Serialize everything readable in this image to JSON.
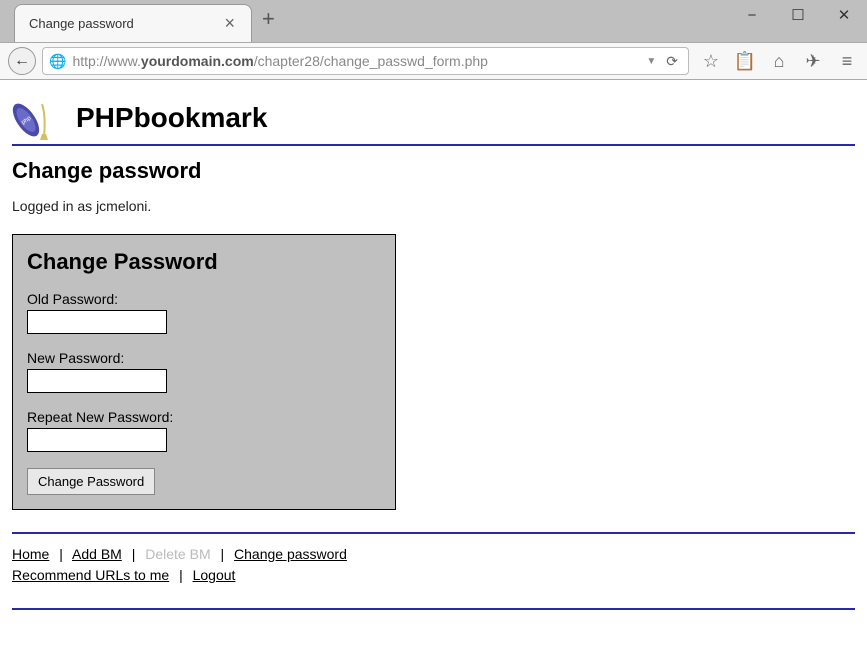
{
  "window": {
    "tab_title": "Change password",
    "controls": {
      "minimize": "−",
      "maximize": "☐",
      "close": "✕"
    },
    "new_tab": "+",
    "tab_close": "×"
  },
  "addressbar": {
    "back": "←",
    "globe": "🌐",
    "url_prefix": "http://www.",
    "url_domain": "yourdomain.com",
    "url_path": "/chapter28/change_passwd_form.php",
    "dropdown": "▼",
    "reload": "⟳"
  },
  "toolbar": {
    "star": "☆",
    "clipboard": "📋",
    "home": "⌂",
    "send": "✈",
    "menu": "≡"
  },
  "brand": {
    "title": "PHPbookmark"
  },
  "page": {
    "heading": "Change password",
    "logged_in": "Logged in as jcmeloni."
  },
  "form": {
    "title": "Change Password",
    "old_label": "Old Password:",
    "new_label": "New Password:",
    "repeat_label": "Repeat New Password:",
    "submit": "Change Password",
    "old_value": "",
    "new_value": "",
    "repeat_value": ""
  },
  "footer": {
    "home": "Home",
    "add_bm": "Add BM",
    "delete_bm": "Delete BM",
    "change_pw": "Change password",
    "recommend": "Recommend URLs to me",
    "logout": "Logout",
    "sep": "|"
  }
}
